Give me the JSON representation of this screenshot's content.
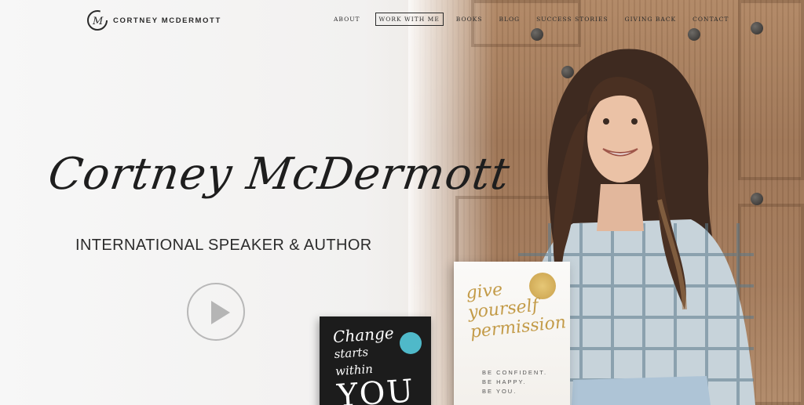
{
  "brand": {
    "name": "CORTNEY MCDERMOTT",
    "logo_letter": "M"
  },
  "nav": {
    "items": [
      {
        "label": "ABOUT"
      },
      {
        "label": "WORK WITH ME"
      },
      {
        "label": "BOOKS"
      },
      {
        "label": "BLOG"
      },
      {
        "label": "SUCCESS STORIES"
      },
      {
        "label": "GIVING BACK"
      },
      {
        "label": "CONTACT"
      }
    ]
  },
  "hero": {
    "signature": "Cortney McDermott",
    "subtitle": "INTERNATIONAL SPEAKER & AUTHOR",
    "play_icon": "play-icon"
  },
  "books": {
    "black": {
      "title_line1": "Change",
      "title_line2": "starts within",
      "title_line3": "YOU"
    },
    "white": {
      "title_line1": "give",
      "title_line2": "yourself",
      "title_line3": "permission",
      "tagline_1": "BE CONFIDENT.",
      "tagline_2": "BE HAPPY.",
      "tagline_3": "BE YOU."
    }
  },
  "colors": {
    "text_dark": "#2b2b2b",
    "gold": "#c39b48",
    "play_grey": "#b5b5b5"
  }
}
